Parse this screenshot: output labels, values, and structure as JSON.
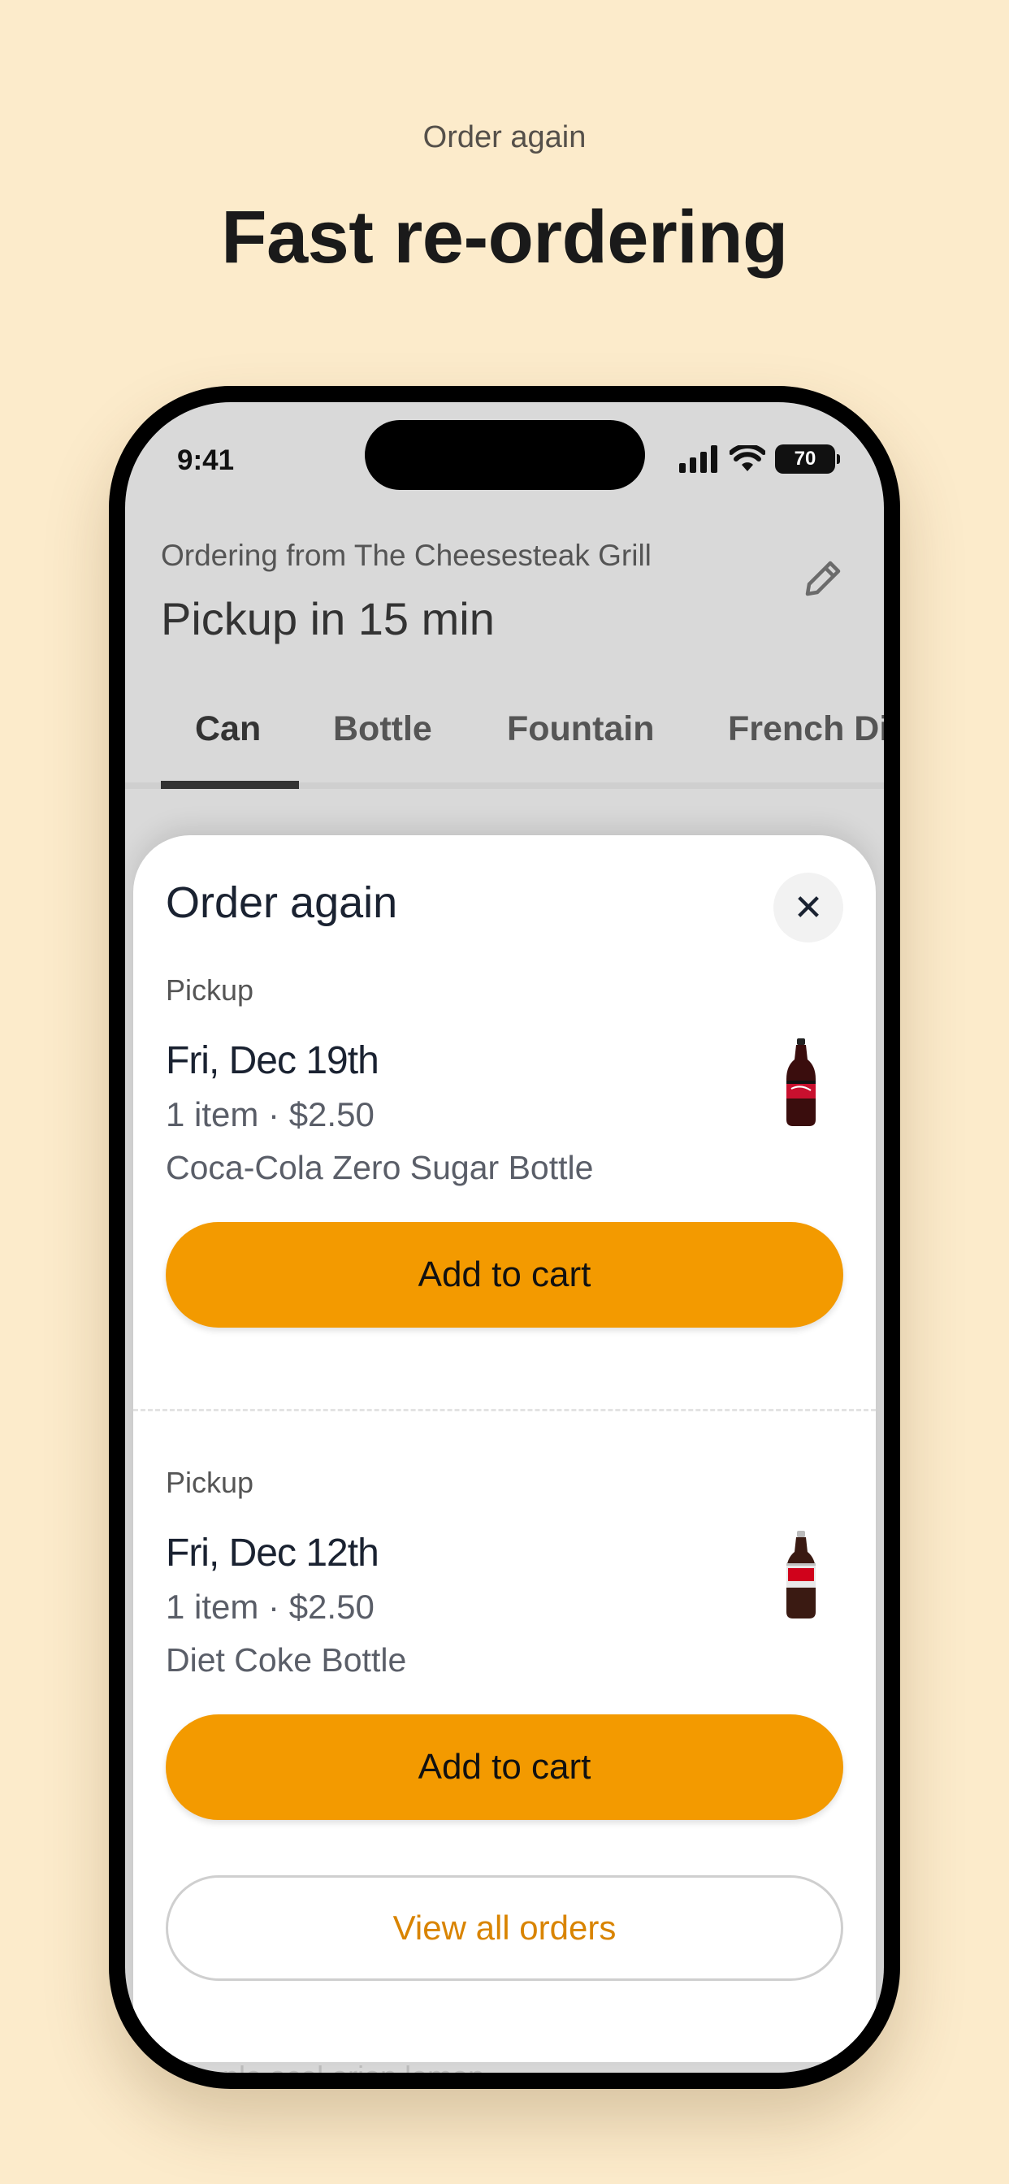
{
  "promo": {
    "eyebrow": "Order again",
    "title": "Fast re-ordering"
  },
  "status_bar": {
    "time": "9:41",
    "battery": "70",
    "icons": [
      "signal-icon",
      "wifi-icon",
      "battery-icon"
    ]
  },
  "header": {
    "ordering_from": "Ordering from The Cheesesteak Grill",
    "pickup_eta": "Pickup in 15 min",
    "edit_icon": "pencil-icon"
  },
  "tabs": [
    {
      "label": "Can",
      "active": true
    },
    {
      "label": "Bottle",
      "active": false
    },
    {
      "label": "Fountain",
      "active": false
    },
    {
      "label": "French Di",
      "active": false
    }
  ],
  "background_text": "...ple acel orion lemon",
  "sheet": {
    "title": "Order again",
    "close_icon": "close-icon",
    "orders": [
      {
        "type": "Pickup",
        "date": "Fri, Dec 19th",
        "meta": "1 item · $2.50",
        "item": "Coca-Cola Zero Sugar Bottle",
        "thumb": "coke-zero-bottle-icon",
        "button": "Add to cart"
      },
      {
        "type": "Pickup",
        "date": "Fri, Dec 12th",
        "meta": "1 item · $2.50",
        "item": "Diet Coke Bottle",
        "thumb": "diet-coke-bottle-icon",
        "button": "Add to cart"
      }
    ],
    "view_all": "View all orders"
  },
  "colors": {
    "background": "#fcebcb",
    "accent": "#f39a00",
    "link": "#d98400"
  }
}
